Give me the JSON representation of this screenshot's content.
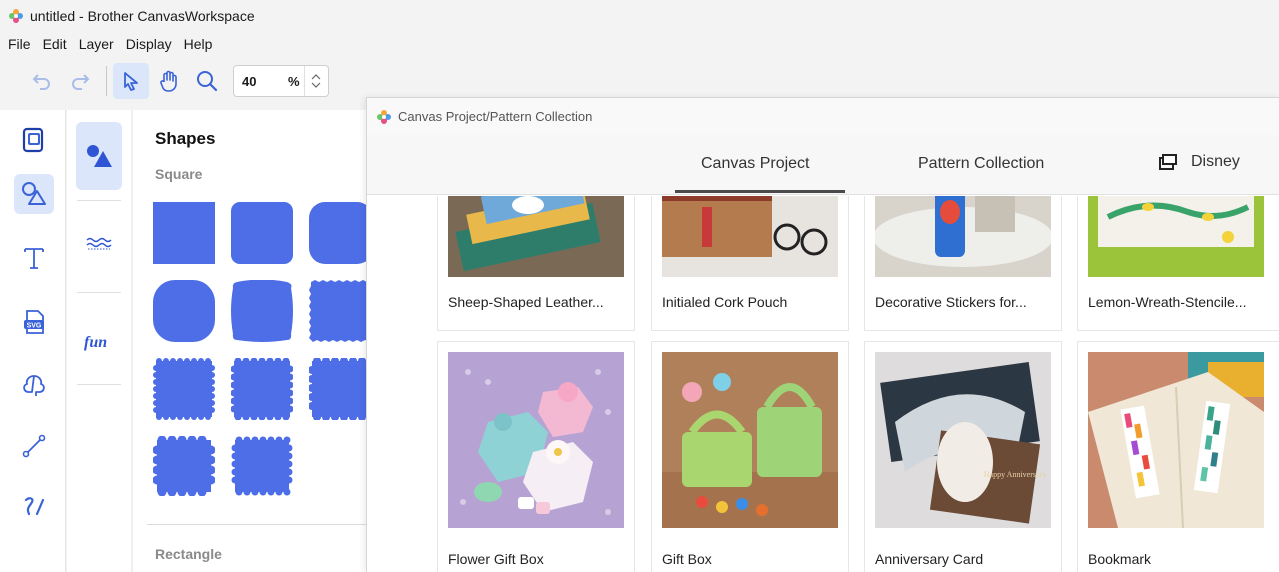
{
  "window": {
    "title": "untitled - Brother CanvasWorkspace"
  },
  "menu": [
    "File",
    "Edit",
    "Layer",
    "Display",
    "Help"
  ],
  "toolbar": {
    "zoom_value": "40",
    "zoom_unit": "%"
  },
  "shapes_panel": {
    "title": "Shapes",
    "section_square": "Square",
    "section_rectangle": "Rectangle"
  },
  "dialog": {
    "title": "Canvas Project/Pattern Collection",
    "tabs": [
      "Canvas Project",
      "Pattern Collection",
      "Disney"
    ],
    "active_tab": "Canvas Project",
    "projects_row1": [
      "Sheep-Shaped Leather...",
      "Initialed Cork Pouch",
      "Decorative Stickers for...",
      "Lemon-Wreath-Stencile..."
    ],
    "projects_row2": [
      "Flower Gift Box",
      "Gift Box",
      "Anniversary Card",
      "Bookmark"
    ],
    "card_text_happy_anniversary": "Happy Anniversary"
  },
  "colors": {
    "accent": "#4e6ee8",
    "active_bg": "#dbe6fb",
    "icon_blue": "#3a63d8"
  },
  "icons": [
    "undo-icon",
    "redo-icon",
    "select-arrow-icon",
    "hand-icon",
    "zoom-icon",
    "project-icon",
    "shapes-icon",
    "text-icon",
    "svg-icon",
    "cloud-outline-icon",
    "line-icon",
    "pen-icon",
    "triangle-circle-icon",
    "wave-line-icon",
    "fun-text-icon",
    "window-icon"
  ]
}
